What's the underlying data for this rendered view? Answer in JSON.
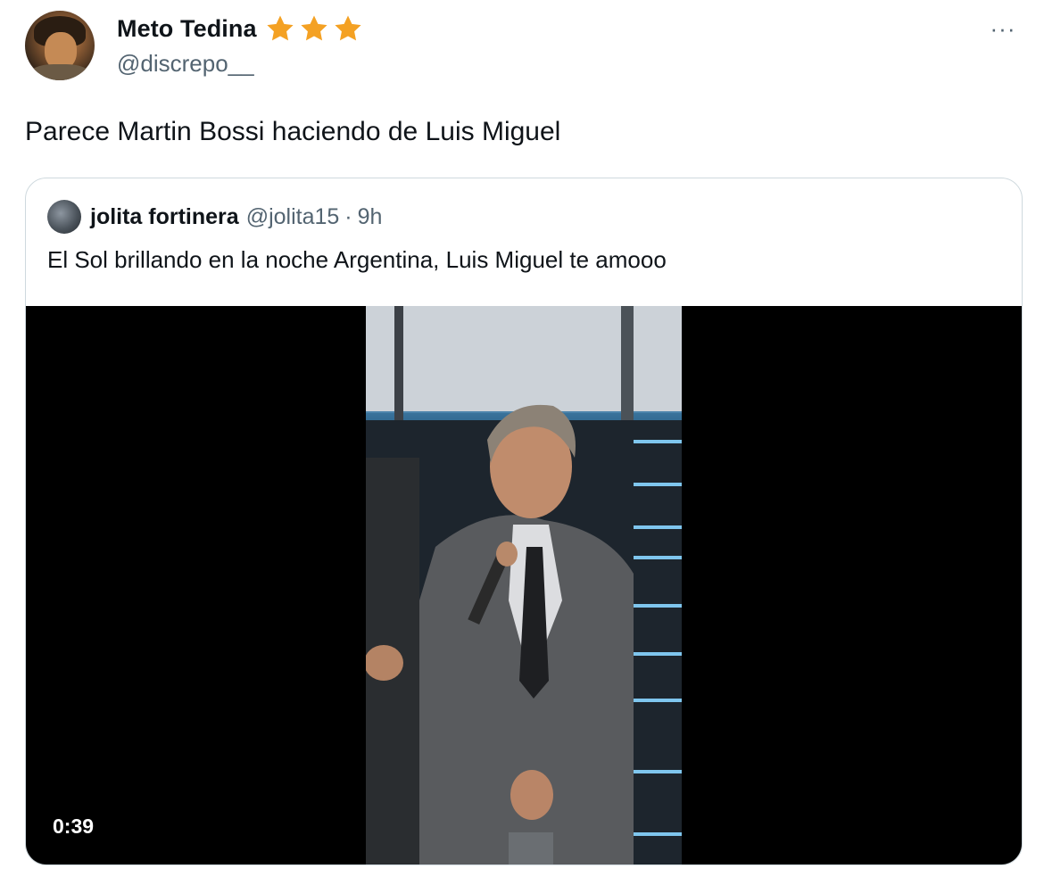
{
  "tweet": {
    "display_name": "Meto Tedina",
    "handle": "@discrepo__",
    "text": "Parece Martin Bossi haciendo de Luis Miguel",
    "badge_icons": [
      "star-icon",
      "star-icon",
      "star-icon"
    ],
    "badge_color": "#f4a123",
    "more_label": "···"
  },
  "quote": {
    "display_name": "jolita fortinera",
    "handle": "@jolita15",
    "separator": "·",
    "time": "9h",
    "text": "El Sol brillando en la noche Argentina, Luis Miguel te amooo",
    "video": {
      "duration": "0:39"
    }
  },
  "colors": {
    "text_primary": "#0f1419",
    "text_secondary": "#536471",
    "border": "#cfd9de",
    "video_background": "#000000"
  }
}
